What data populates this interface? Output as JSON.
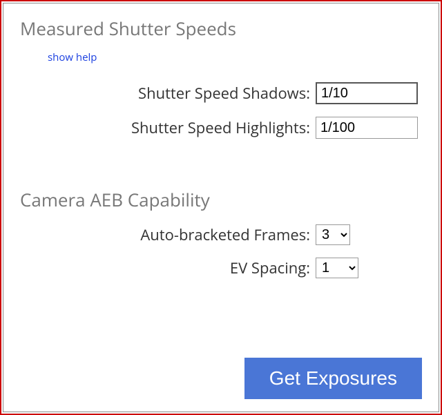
{
  "section1": {
    "heading": "Measured Shutter Speeds",
    "help_link": "show help",
    "shadows_label": "Shutter Speed Shadows:",
    "shadows_value": "1/10",
    "highlights_label": "Shutter Speed Highlights:",
    "highlights_value": "1/100"
  },
  "section2": {
    "heading": "Camera AEB Capability",
    "frames_label": "Auto-bracketed Frames:",
    "frames_value": "3",
    "spacing_label": "EV Spacing:",
    "spacing_value": "1"
  },
  "submit_label": "Get Exposures"
}
